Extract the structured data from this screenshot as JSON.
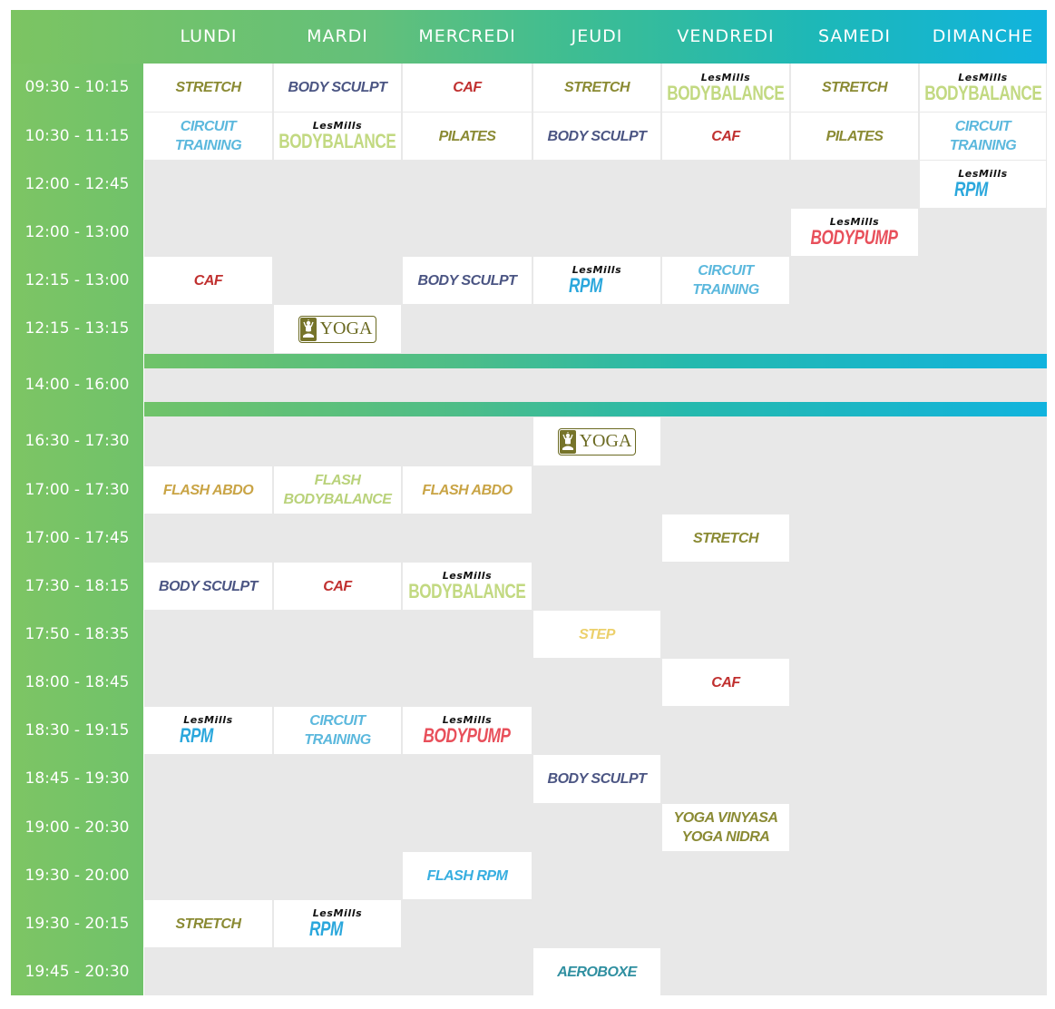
{
  "colors": {
    "stretch": "#8a8a33",
    "body_sculpt": "#4b5583",
    "caf": "#c0302f",
    "circuit": "#5bb8dd",
    "pilates": "#8a8a33",
    "bodybalance": "#c2d981",
    "bodypump": "#e8505b",
    "rpm": "#2aa7dc",
    "flash_abdo": "#c9a445",
    "flash_bodybalance": "#b9d27a",
    "step": "#ecd06b",
    "yoga_vinyasa": "#8a8a33",
    "flash_rpm": "#36aee0",
    "aeroboxe": "#2f8fa0"
  },
  "days": [
    "LUNDI",
    "MARDI",
    "MERCREDI",
    "JEUDI",
    "VENDREDI",
    "SAMEDI",
    "DIMANCHE"
  ],
  "lesmills_label": "LesMills",
  "time_slots": [
    "09:30 - 10:15",
    "10:30 - 11:15",
    "12:00 - 12:45",
    "12:00 - 13:00",
    "12:15 - 13:00",
    "12:15 - 13:15",
    "14:00 - 16:00",
    "16:30 - 17:30",
    "17:00 - 17:30",
    "17:00 - 17:45",
    "17:30 - 18:15",
    "17:50 - 18:35",
    "18:00 - 18:45",
    "18:30 - 19:15",
    "18:45 - 19:30",
    "19:00 - 20:30",
    "19:30 - 20:00",
    "19:30 - 20:15",
    "19:45 - 20:30"
  ],
  "classes": [
    {
      "slot": 0,
      "day": 0,
      "type": "text",
      "lines": [
        "STRETCH"
      ],
      "color": "#8a8a33"
    },
    {
      "slot": 0,
      "day": 1,
      "type": "text",
      "lines": [
        "BODY SCULPT"
      ],
      "color": "#4b5583"
    },
    {
      "slot": 0,
      "day": 2,
      "type": "text",
      "lines": [
        "CAF"
      ],
      "color": "#c0302f"
    },
    {
      "slot": 0,
      "day": 3,
      "type": "text",
      "lines": [
        "STRETCH"
      ],
      "color": "#8a8a33"
    },
    {
      "slot": 0,
      "day": 4,
      "type": "lesmills",
      "program": "BODYBALANCE",
      "color": "#c2d981"
    },
    {
      "slot": 0,
      "day": 5,
      "type": "text",
      "lines": [
        "STRETCH"
      ],
      "color": "#8a8a33"
    },
    {
      "slot": 0,
      "day": 6,
      "type": "lesmills",
      "program": "BODYBALANCE",
      "color": "#c2d981"
    },
    {
      "slot": 1,
      "day": 0,
      "type": "text",
      "lines": [
        "CIRCUIT",
        "TRAINING"
      ],
      "color": "#5bb8dd"
    },
    {
      "slot": 1,
      "day": 1,
      "type": "lesmills",
      "program": "BODYBALANCE",
      "color": "#c2d981"
    },
    {
      "slot": 1,
      "day": 2,
      "type": "text",
      "lines": [
        "PILATES"
      ],
      "color": "#8a8a33"
    },
    {
      "slot": 1,
      "day": 3,
      "type": "text",
      "lines": [
        "BODY SCULPT"
      ],
      "color": "#4b5583"
    },
    {
      "slot": 1,
      "day": 4,
      "type": "text",
      "lines": [
        "CAF"
      ],
      "color": "#c0302f"
    },
    {
      "slot": 1,
      "day": 5,
      "type": "text",
      "lines": [
        "PILATES"
      ],
      "color": "#8a8a33"
    },
    {
      "slot": 1,
      "day": 6,
      "type": "text",
      "lines": [
        "CIRCUIT",
        "TRAINING"
      ],
      "color": "#5bb8dd"
    },
    {
      "slot": 2,
      "day": 6,
      "type": "lesmills",
      "program": "RPM",
      "color": "#2aa7dc"
    },
    {
      "slot": 3,
      "day": 5,
      "type": "lesmills",
      "program": "BODYPUMP",
      "color": "#e8505b"
    },
    {
      "slot": 4,
      "day": 0,
      "type": "text",
      "lines": [
        "CAF"
      ],
      "color": "#c0302f"
    },
    {
      "slot": 4,
      "day": 2,
      "type": "text",
      "lines": [
        "BODY SCULPT"
      ],
      "color": "#4b5583"
    },
    {
      "slot": 4,
      "day": 3,
      "type": "lesmills",
      "program": "RPM",
      "color": "#2aa7dc"
    },
    {
      "slot": 4,
      "day": 4,
      "type": "text",
      "lines": [
        "CIRCUIT",
        "TRAINING"
      ],
      "color": "#5bb8dd"
    },
    {
      "slot": 5,
      "day": 1,
      "type": "yoga",
      "label": "YOGA"
    },
    {
      "slot": 7,
      "day": 3,
      "type": "yoga",
      "label": "YOGA"
    },
    {
      "slot": 8,
      "day": 0,
      "type": "text",
      "lines": [
        "FLASH ABDO"
      ],
      "color": "#c9a445"
    },
    {
      "slot": 8,
      "day": 1,
      "type": "text",
      "lines": [
        "FLASH",
        "BODYBALANCE"
      ],
      "color": "#b9d27a"
    },
    {
      "slot": 8,
      "day": 2,
      "type": "text",
      "lines": [
        "FLASH ABDO"
      ],
      "color": "#c9a445"
    },
    {
      "slot": 9,
      "day": 4,
      "type": "text",
      "lines": [
        "STRETCH"
      ],
      "color": "#8a8a33"
    },
    {
      "slot": 10,
      "day": 0,
      "type": "text",
      "lines": [
        "BODY SCULPT"
      ],
      "color": "#4b5583"
    },
    {
      "slot": 10,
      "day": 1,
      "type": "text",
      "lines": [
        "CAF"
      ],
      "color": "#c0302f"
    },
    {
      "slot": 10,
      "day": 2,
      "type": "lesmills",
      "program": "BODYBALANCE",
      "color": "#c2d981"
    },
    {
      "slot": 11,
      "day": 3,
      "type": "text",
      "lines": [
        "STEP"
      ],
      "color": "#ecd06b"
    },
    {
      "slot": 12,
      "day": 4,
      "type": "text",
      "lines": [
        "CAF"
      ],
      "color": "#c0302f"
    },
    {
      "slot": 13,
      "day": 0,
      "type": "lesmills",
      "program": "RPM",
      "color": "#2aa7dc"
    },
    {
      "slot": 13,
      "day": 1,
      "type": "text",
      "lines": [
        "CIRCUIT",
        "TRAINING"
      ],
      "color": "#5bb8dd"
    },
    {
      "slot": 13,
      "day": 2,
      "type": "lesmills",
      "program": "BODYPUMP",
      "color": "#e8505b"
    },
    {
      "slot": 14,
      "day": 3,
      "type": "text",
      "lines": [
        "BODY SCULPT"
      ],
      "color": "#4b5583"
    },
    {
      "slot": 15,
      "day": 4,
      "type": "text",
      "lines": [
        "YOGA VINYASA",
        "YOGA NIDRA"
      ],
      "color": "#8a8a33"
    },
    {
      "slot": 16,
      "day": 2,
      "type": "text",
      "lines": [
        "FLASH RPM"
      ],
      "color": "#36aee0"
    },
    {
      "slot": 17,
      "day": 0,
      "type": "text",
      "lines": [
        "STRETCH"
      ],
      "color": "#8a8a33"
    },
    {
      "slot": 17,
      "day": 1,
      "type": "lesmills",
      "program": "RPM",
      "color": "#2aa7dc"
    },
    {
      "slot": 18,
      "day": 3,
      "type": "text",
      "lines": [
        "AEROBOXE"
      ],
      "color": "#2f8fa0"
    }
  ]
}
